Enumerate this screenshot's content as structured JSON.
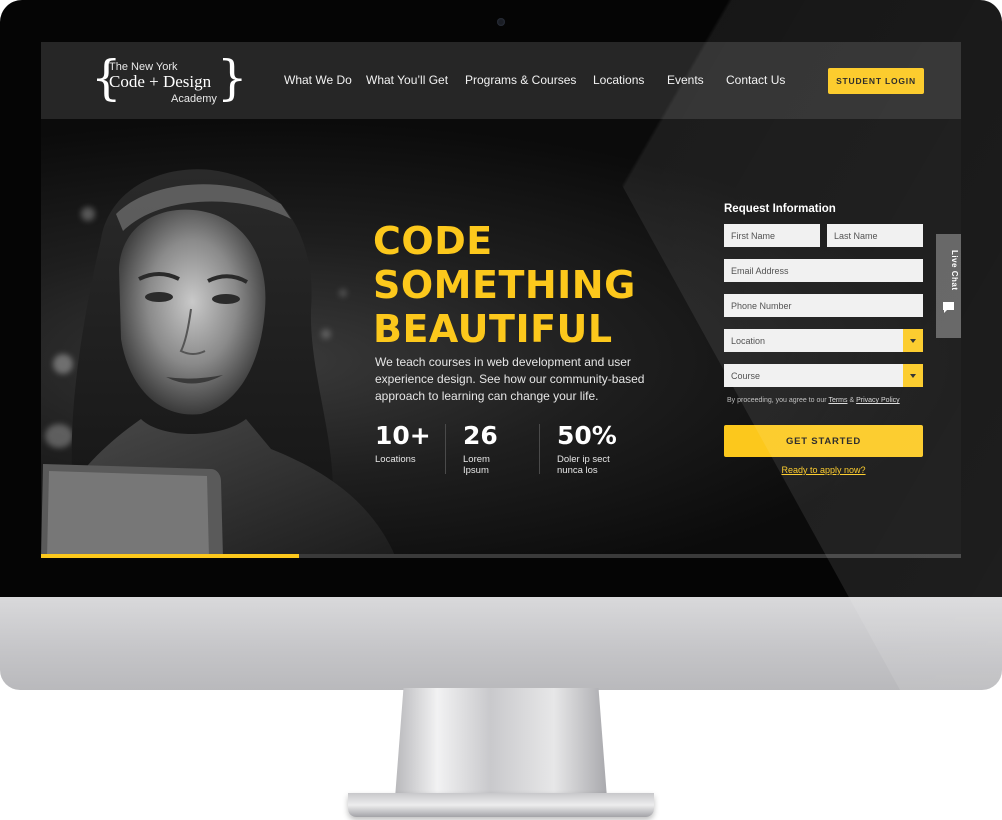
{
  "logo": {
    "line1": "The New York",
    "line2": "Code + Design",
    "line3": "Academy",
    "brace_open": "{",
    "brace_close": "}"
  },
  "nav": {
    "items": [
      {
        "label": "What We Do"
      },
      {
        "label": "What You’ll Get"
      },
      {
        "label": "Programs & Courses"
      },
      {
        "label": "Locations"
      },
      {
        "label": "Events"
      },
      {
        "label": "Contact Us"
      }
    ],
    "login_label": "STUDENT LOGIN"
  },
  "hero": {
    "title_lines": [
      "CODE",
      "SOMETHING",
      "BEAUTIFUL"
    ],
    "description": "We teach courses in web development and user experience design. See how our community-based approach to learning can change your life.",
    "stats": [
      {
        "value": "10+",
        "label": "Locations"
      },
      {
        "value": "26",
        "label": "Lorem Ipsum"
      },
      {
        "value": "50%",
        "label": "Doler ip sect nunca los"
      }
    ]
  },
  "form": {
    "title": "Request Information",
    "first_name_placeholder": "First Name",
    "last_name_placeholder": "Last Name",
    "email_placeholder": "Email Address",
    "phone_placeholder": "Phone Number",
    "location_selected": "Location",
    "course_selected": "Course",
    "agree_prefix": "By proceeding, you agree to our ",
    "terms_label": "Terms",
    "agree_amp": " & ",
    "privacy_label": "Privacy Policy",
    "submit_label": "GET STARTED",
    "apply_link": "Ready to apply now?"
  },
  "live_chat": {
    "label": "Live Chat",
    "icon": "speech-bubble-icon"
  },
  "slider": {
    "progress": 0.28
  },
  "colors": {
    "accent": "#fcc81c",
    "header_bg": "#262626",
    "hero_bg": "#0c0c0c",
    "field_bg": "#f0f0f0"
  }
}
